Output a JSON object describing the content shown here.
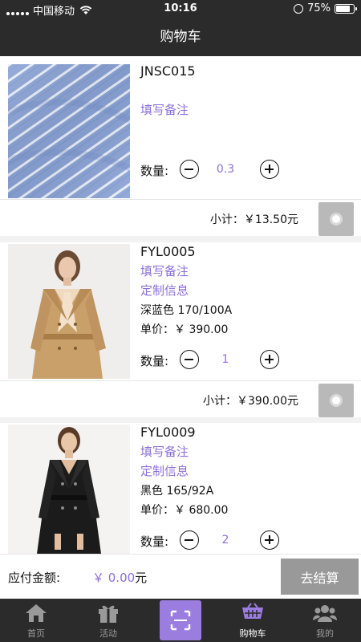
{
  "status_bar": {
    "carrier": "中国移动",
    "time": "10:16",
    "battery": "75%"
  },
  "header": {
    "title": "购物车"
  },
  "cart": {
    "items": [
      {
        "code": "JNSC015",
        "note_link": "填写备注",
        "quantity_label": "数量:",
        "quantity": "0.3",
        "subtotal": "小计：￥13.50元",
        "image": "blue-white-striped-fabric"
      },
      {
        "code": "FYL0005",
        "note_link": "填写备注",
        "custom_link": "定制信息",
        "spec": "深蓝色 170/100A",
        "unit_price": "单价：￥ 390.00",
        "quantity_label": "数量:",
        "quantity": "1",
        "subtotal": "小计：￥390.00元",
        "image": "beige-trench-coat-model"
      },
      {
        "code": "FYL0009",
        "note_link": "填写备注",
        "custom_link": "定制信息",
        "spec": "黑色 165/92A",
        "unit_price": "单价：￥ 680.00",
        "quantity_label": "数量:",
        "quantity": "2",
        "image": "black-trench-coat-model"
      }
    ]
  },
  "total": {
    "label": "应付金额:",
    "amount": "￥ 0.00",
    "unit": "元",
    "checkout_label": "去结算"
  },
  "tabs": [
    {
      "label": "首页",
      "icon": "home-icon"
    },
    {
      "label": "活动",
      "icon": "gift-icon"
    },
    {
      "label": "",
      "icon": "scan-icon"
    },
    {
      "label": "购物车",
      "icon": "cart-icon",
      "active": true
    },
    {
      "label": "我的",
      "icon": "users-icon"
    }
  ],
  "colors": {
    "accent": "#8c6fd8",
    "bar_bg": "#2b2b2b",
    "checkout_bg": "#999999"
  }
}
